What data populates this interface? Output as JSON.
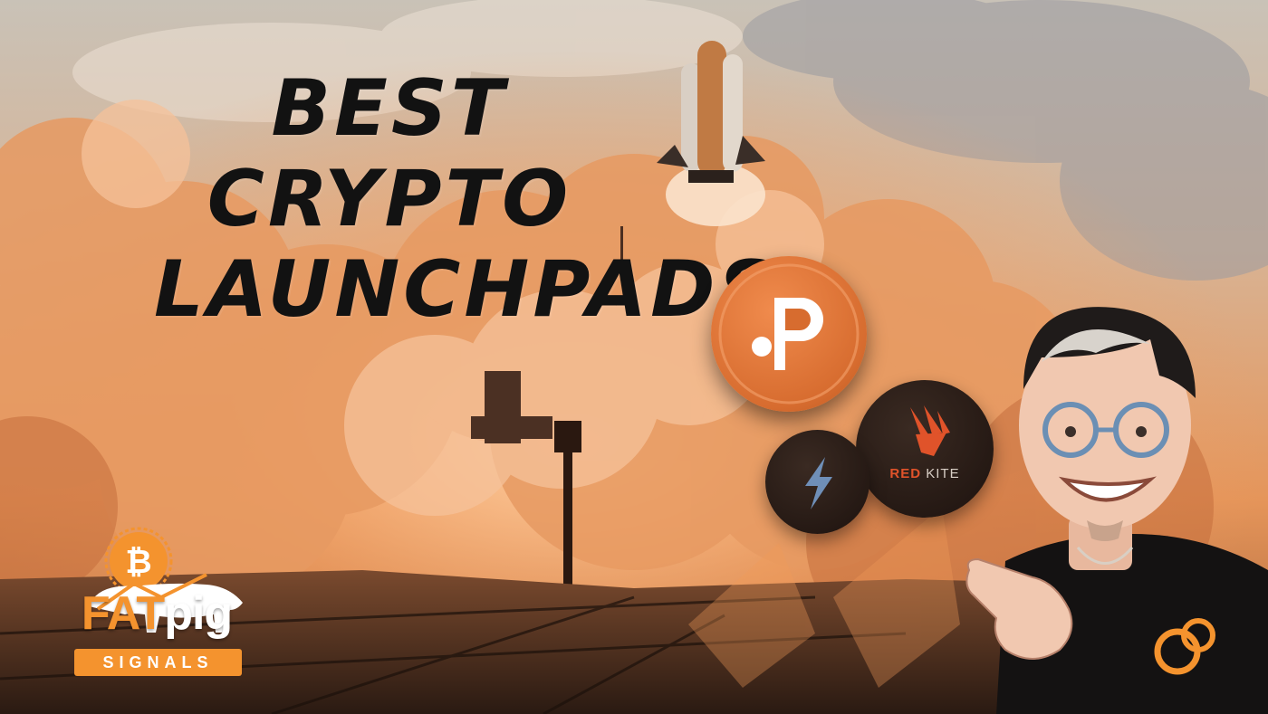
{
  "headline": {
    "lines": [
      "BEST",
      "CRYPTO",
      "LAUNCHPADS!"
    ]
  },
  "coins": {
    "p_coin_icon": "polkastarter-p-icon",
    "bolt_coin_icon": "lightning-bolt-icon",
    "kite_coin": {
      "icon": "red-kite-bird-icon",
      "label_red": "RED",
      "label_rest": "KITE"
    }
  },
  "logo": {
    "word_fat": "FAT",
    "word_pig": "pig",
    "subtitle": "SIGNALS",
    "icon": "bitcoin-pig-icon"
  },
  "colors": {
    "accent_orange": "#f4932e",
    "coin_orange": "#d76c2f",
    "kite_red": "#e0532a"
  }
}
